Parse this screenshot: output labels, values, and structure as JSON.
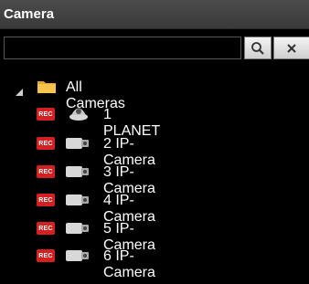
{
  "header": {
    "title": "Camera"
  },
  "search": {
    "value": "",
    "placeholder": ""
  },
  "tree": {
    "root": {
      "label": "All Cameras",
      "icon": "folder-icon",
      "expanded": true
    },
    "cameras": [
      {
        "badge": "REC",
        "icon": "dome-camera-icon",
        "label": "1 PLANET"
      },
      {
        "badge": "REC",
        "icon": "ip-camera-icon",
        "label": "2 IP-Camera"
      },
      {
        "badge": "REC",
        "icon": "ip-camera-icon",
        "label": "3 IP-Camera"
      },
      {
        "badge": "REC",
        "icon": "ip-camera-icon",
        "label": "4 IP-Camera"
      },
      {
        "badge": "REC",
        "icon": "ip-camera-icon",
        "label": "5 IP-Camera"
      },
      {
        "badge": "REC",
        "icon": "ip-camera-icon",
        "label": "6 IP-Camera"
      }
    ]
  },
  "colors": {
    "rec_badge": "#d42020",
    "header_bg": "#444444",
    "background": "#000000"
  }
}
